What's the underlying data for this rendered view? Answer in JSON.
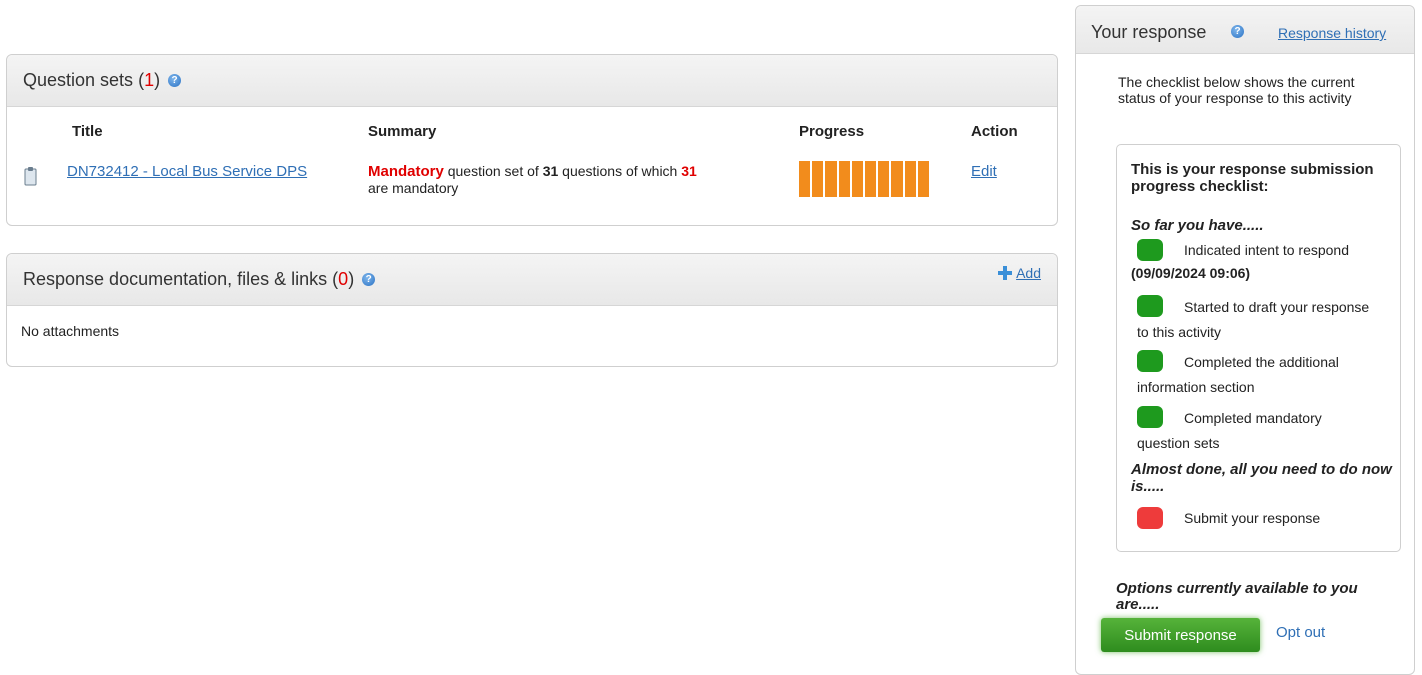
{
  "question_sets": {
    "title": "Question sets",
    "count_open": "(",
    "count": "1",
    "count_close": ")",
    "headers": {
      "title": "Title",
      "summary": "Summary",
      "progress": "Progress",
      "action": "Action"
    },
    "row": {
      "title": "DN732412 - Local Bus Service DPS",
      "summary_mandatory": "Mandatory",
      "summary_mid": " question set of ",
      "summary_total": "31",
      "summary_mid2": " questions of which ",
      "summary_mandatory_count": "31",
      "summary_tail": "are mandatory",
      "progress_segments": 10,
      "progress_fraction": 1.0,
      "action": "Edit"
    }
  },
  "documentation": {
    "title": "Response documentation, files & links",
    "count_open": "(",
    "count": "0",
    "count_close": ")",
    "add_label": "Add",
    "empty_text": "No attachments"
  },
  "your_response": {
    "title": "Your response",
    "history_link": "Response history",
    "intro": "The checklist below shows the current status of your response to this activity",
    "checklist_title": "This is your response submission progress checklist:",
    "so_far": "So far you have.....",
    "items": [
      {
        "text": "Indicated intent to respond",
        "extra": "(09/09/2024 09:06)",
        "status": "green"
      },
      {
        "text": "Started to draft your response to this activity",
        "status": "green"
      },
      {
        "text": "Completed the additional information section",
        "status": "green"
      },
      {
        "text": "Completed mandatory question sets",
        "status": "green"
      }
    ],
    "almost_done": "Almost done, all you need to do now is.....",
    "final_item": {
      "text": "Submit your response",
      "status": "red"
    },
    "options_text": "Options currently available to you are.....",
    "submit_button": "Submit response",
    "opt_out": "Opt out"
  },
  "colors": {
    "progress": "#f28c1c",
    "status_green": "#1e9a1e",
    "status_red": "#ee3b3b",
    "link": "#2f6fb5"
  }
}
